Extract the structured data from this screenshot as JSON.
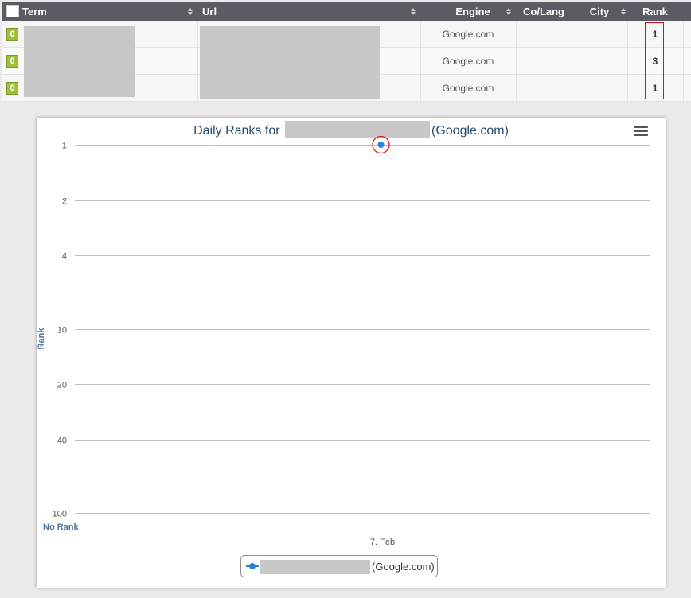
{
  "table": {
    "headers": {
      "term": "Term",
      "url": "Url",
      "engine": "Engine",
      "colang": "Co/Lang",
      "city": "City",
      "rank": "Rank"
    },
    "rows": [
      {
        "badge": "0",
        "engine": "Google.com",
        "colang": "",
        "city": "",
        "rank": "1"
      },
      {
        "badge": "0",
        "engine": "Google.com",
        "colang": "",
        "city": "",
        "rank": "3"
      },
      {
        "badge": "0",
        "engine": "Google.com",
        "colang": "",
        "city": "",
        "rank": "1"
      }
    ]
  },
  "chart": {
    "title_prefix": "Daily Ranks for",
    "title_suffix": "(Google.com)",
    "legend_suffix": "(Google.com)",
    "menu_icon": "hamburger-menu-icon",
    "accent_color": "#2f7ed8",
    "highlight_color": "#dd1111"
  },
  "chart_data": {
    "type": "line",
    "ylabel": "Rank",
    "yscale": "log",
    "yreversed": true,
    "yticks": [
      "1",
      "2",
      "4",
      "10",
      "20",
      "40",
      "100"
    ],
    "y_extra_label": "No Rank",
    "xticks": [
      "7. Feb"
    ],
    "series": [
      {
        "x": [
          "7. Feb"
        ],
        "values": [
          1
        ]
      }
    ]
  }
}
